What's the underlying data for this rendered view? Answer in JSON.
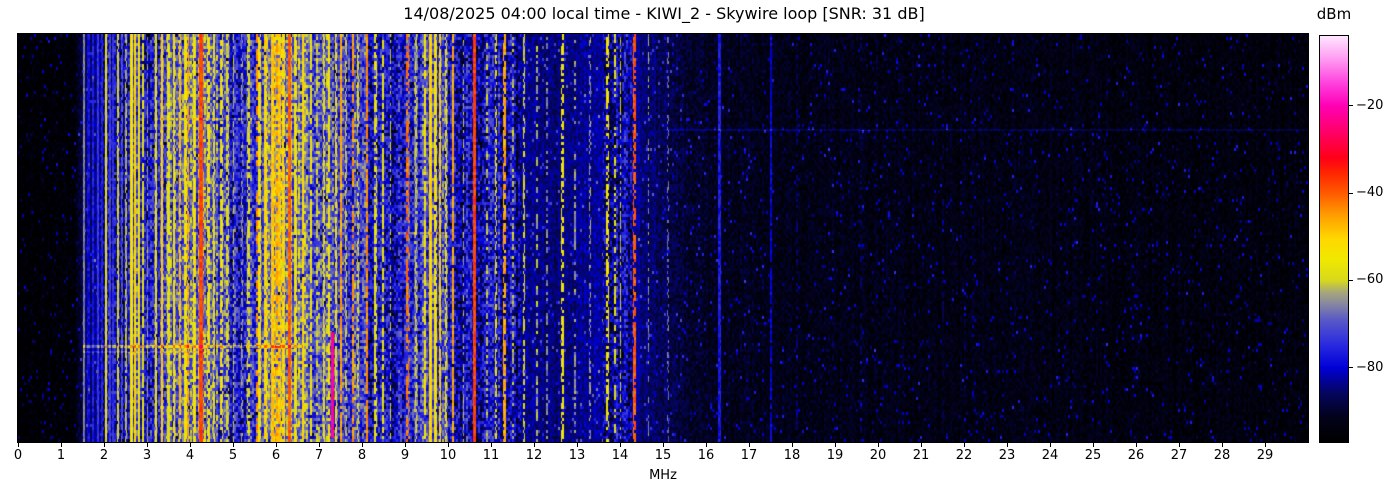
{
  "chart_data": {
    "type": "heatmap",
    "variant": "radio-spectrum-waterfall",
    "title": "14/08/2025 04:00 local time - KIWI_2 - Skywire loop [SNR: 31 dB]",
    "datetime_local": "14/08/2025 04:00",
    "station": "KIWI_2",
    "antenna": "Skywire loop",
    "snr_db": 31,
    "xlabel": "MHz",
    "x_range": [
      0,
      30
    ],
    "x_ticks": [
      0,
      1,
      2,
      3,
      4,
      5,
      6,
      7,
      8,
      9,
      10,
      11,
      12,
      13,
      14,
      15,
      16,
      17,
      18,
      19,
      20,
      21,
      22,
      23,
      24,
      25,
      26,
      27,
      28,
      29
    ],
    "value_label": "dBm",
    "value_range": [
      -97,
      -4
    ],
    "colorbar_ticks": [
      -20,
      -40,
      -60,
      -80
    ],
    "layout": {
      "grid": false,
      "colorbar_position": "right",
      "time_axis": "vertical-unlabeled"
    },
    "colormap": [
      [
        0.0,
        "#000000"
      ],
      [
        0.06,
        "#02021a"
      ],
      [
        0.12,
        "#05055e"
      ],
      [
        0.183,
        "#0000d6"
      ],
      [
        0.24,
        "#2a2ae0"
      ],
      [
        0.3,
        "#5858c8"
      ],
      [
        0.345,
        "#8c8c9c"
      ],
      [
        0.37,
        "#a8a878"
      ],
      [
        0.398,
        "#d8d81c"
      ],
      [
        0.45,
        "#f0e800"
      ],
      [
        0.5,
        "#ffd800"
      ],
      [
        0.56,
        "#ff9c00"
      ],
      [
        0.613,
        "#ff5a00"
      ],
      [
        0.66,
        "#ff2800"
      ],
      [
        0.7,
        "#ff0018"
      ],
      [
        0.76,
        "#ff0064"
      ],
      [
        0.828,
        "#ff00b4"
      ],
      [
        0.88,
        "#ff3cdc"
      ],
      [
        0.94,
        "#ff96f0"
      ],
      [
        1.0,
        "#ffe6ff"
      ]
    ],
    "noise_floor_profile": [
      [
        0.0,
        -96
      ],
      [
        1.3,
        -96
      ],
      [
        1.5,
        -88
      ],
      [
        1.7,
        -84
      ],
      [
        1.9,
        -82
      ],
      [
        2.1,
        -78
      ],
      [
        2.5,
        -80
      ],
      [
        2.7,
        -72
      ],
      [
        3.1,
        -76
      ],
      [
        3.4,
        -70
      ],
      [
        3.9,
        -68
      ],
      [
        4.3,
        -66
      ],
      [
        4.8,
        -72
      ],
      [
        5.1,
        -78
      ],
      [
        5.5,
        -72
      ],
      [
        5.8,
        -66
      ],
      [
        6.2,
        -64
      ],
      [
        6.6,
        -66
      ],
      [
        6.9,
        -72
      ],
      [
        7.2,
        -68
      ],
      [
        7.5,
        -74
      ],
      [
        7.9,
        -72
      ],
      [
        8.3,
        -78
      ],
      [
        8.7,
        -80
      ],
      [
        9.1,
        -74
      ],
      [
        9.5,
        -72
      ],
      [
        9.9,
        -74
      ],
      [
        10.3,
        -79
      ],
      [
        10.8,
        -80
      ],
      [
        11.3,
        -78
      ],
      [
        11.7,
        -82
      ],
      [
        12.3,
        -85
      ],
      [
        12.9,
        -84
      ],
      [
        13.6,
        -82
      ],
      [
        14.1,
        -80
      ],
      [
        14.6,
        -85
      ],
      [
        15.2,
        -88
      ],
      [
        16.0,
        -91
      ],
      [
        18.0,
        -92
      ],
      [
        21.0,
        -93
      ],
      [
        24.0,
        -93
      ],
      [
        27.0,
        -94
      ],
      [
        30.0,
        -94
      ]
    ],
    "carrier_format": "[freq_MHz, peak_dBm, width_MHz, duty_0to1, t_start_frac(optional), t_end_frac(optional)]",
    "carriers": [
      [
        1.52,
        -66,
        0.02,
        1
      ],
      [
        1.62,
        -78,
        0.04,
        1
      ],
      [
        1.74,
        -76,
        0.03,
        1
      ],
      [
        1.85,
        -73,
        0.02,
        1
      ],
      [
        1.95,
        -76,
        0.02,
        1
      ],
      [
        2.03,
        -56,
        0.03,
        1
      ],
      [
        2.12,
        -72,
        0.03,
        1
      ],
      [
        2.2,
        -74,
        0.03,
        1
      ],
      [
        2.32,
        -59,
        0.02,
        0.9
      ],
      [
        2.41,
        -70,
        0.02,
        0.8
      ],
      [
        2.49,
        -62,
        0.02,
        0.8
      ],
      [
        2.62,
        -54,
        0.04,
        1
      ],
      [
        2.71,
        -51,
        0.04,
        1
      ],
      [
        2.8,
        -54,
        0.04,
        1
      ],
      [
        2.89,
        -57,
        0.03,
        0.9
      ],
      [
        3.0,
        -64,
        0.02,
        0.7
      ],
      [
        3.2,
        -56,
        0.03,
        0.9
      ],
      [
        3.33,
        -50,
        0.03,
        1
      ],
      [
        3.48,
        -57,
        0.04,
        0.85
      ],
      [
        3.62,
        -54,
        0.03,
        0.9
      ],
      [
        3.75,
        -49,
        0.03,
        0.85
      ],
      [
        3.88,
        -55,
        0.04,
        0.9
      ],
      [
        3.95,
        -46,
        0.03,
        0.75
      ],
      [
        4.1,
        -54,
        0.05,
        0.9
      ],
      [
        4.25,
        -38,
        0.07,
        1
      ],
      [
        4.42,
        -54,
        0.03,
        0.8
      ],
      [
        4.55,
        -57,
        0.03,
        0.8
      ],
      [
        4.72,
        -55,
        0.03,
        0.75
      ],
      [
        4.86,
        -59,
        0.03,
        0.7
      ],
      [
        5.0,
        -61,
        0.02,
        0.6
      ],
      [
        5.2,
        -64,
        0.02,
        0.5
      ],
      [
        5.35,
        -59,
        0.03,
        0.7
      ],
      [
        5.55,
        -44,
        0.03,
        0.5
      ],
      [
        5.6,
        -54,
        0.04,
        0.9
      ],
      [
        5.75,
        -51,
        0.04,
        0.9
      ],
      [
        5.9,
        -49,
        0.04,
        1
      ],
      [
        6.0,
        -46,
        0.04,
        0.6
      ],
      [
        6.07,
        -49,
        0.04,
        0.9
      ],
      [
        6.17,
        -51,
        0.04,
        0.9
      ],
      [
        6.3,
        -40,
        0.04,
        1
      ],
      [
        6.45,
        -54,
        0.04,
        0.85
      ],
      [
        6.62,
        -51,
        0.03,
        0.9
      ],
      [
        6.8,
        -56,
        0.03,
        0.8
      ],
      [
        6.95,
        -60,
        0.02,
        0.6
      ],
      [
        7.1,
        -57,
        0.03,
        0.8
      ],
      [
        7.22,
        -54,
        0.03,
        0.8
      ],
      [
        7.3,
        -22,
        0.04,
        1,
        0.73,
        0.99
      ],
      [
        7.38,
        -55,
        0.03,
        0.8
      ],
      [
        7.5,
        -46,
        0.03,
        0.95
      ],
      [
        7.62,
        -60,
        0.02,
        0.6
      ],
      [
        7.78,
        -45,
        0.03,
        0.8
      ],
      [
        7.9,
        -58,
        0.02,
        0.6
      ],
      [
        8.1,
        -44,
        0.03,
        0.9
      ],
      [
        8.3,
        -57,
        0.03,
        0.7
      ],
      [
        8.47,
        -56,
        0.03,
        0.7
      ],
      [
        8.65,
        -60,
        0.02,
        0.5
      ],
      [
        9.05,
        -42,
        0.04,
        0.6
      ],
      [
        9.25,
        -60,
        0.02,
        0.6
      ],
      [
        9.45,
        -54,
        0.03,
        0.8
      ],
      [
        9.58,
        -51,
        0.03,
        1
      ],
      [
        9.7,
        -54,
        0.03,
        0.9
      ],
      [
        9.8,
        -51,
        0.03,
        0.9
      ],
      [
        9.95,
        -56,
        0.03,
        0.7
      ],
      [
        10.1,
        -46,
        0.03,
        0.9
      ],
      [
        10.35,
        -62,
        0.02,
        0.5
      ],
      [
        10.6,
        -38,
        0.05,
        1
      ],
      [
        10.9,
        -62,
        0.02,
        0.5
      ],
      [
        11.1,
        -57,
        0.02,
        0.6
      ],
      [
        11.3,
        -46,
        0.03,
        0.8
      ],
      [
        11.5,
        -62,
        0.02,
        0.5
      ],
      [
        11.75,
        -59,
        0.02,
        0.6
      ],
      [
        12.05,
        -62,
        0.02,
        0.5
      ],
      [
        12.3,
        -66,
        0.02,
        0.5
      ],
      [
        12.65,
        -55,
        0.03,
        0.6
      ],
      [
        12.95,
        -64,
        0.02,
        0.4
      ],
      [
        13.3,
        -64,
        0.02,
        0.4
      ],
      [
        13.7,
        -54,
        0.03,
        0.6
      ],
      [
        13.87,
        -58,
        0.02,
        0.5
      ],
      [
        14.0,
        -60,
        0.02,
        0.5
      ],
      [
        14.32,
        -40,
        0.04,
        0.8
      ],
      [
        14.65,
        -64,
        0.02,
        0.4
      ],
      [
        15.1,
        -68,
        0.02,
        0.4
      ],
      [
        16.3,
        -77,
        0.05,
        1
      ],
      [
        17.5,
        -80,
        0.03,
        0.95
      ],
      [
        18.1,
        -86,
        0.02,
        0.5
      ],
      [
        19.6,
        -87,
        0.02,
        0.4
      ],
      [
        21.5,
        -88,
        0.02,
        0.35
      ]
    ],
    "time_events_note": "horizontal noise streaks: t = fraction from top of plot",
    "time_events": [
      {
        "t": 0.206,
        "f0": 3.2,
        "f1": 5.6,
        "boost": 7,
        "rows": 2
      },
      {
        "t": 0.233,
        "f0": 15.0,
        "f1": 30.0,
        "boost": 6,
        "rows": 2
      },
      {
        "t": 0.485,
        "f0": 8.8,
        "f1": 11.6,
        "boost": 5,
        "rows": 2
      },
      {
        "t": 0.762,
        "f0": 1.5,
        "f1": 6.6,
        "boost": 12,
        "rows": 3
      },
      {
        "t": 0.778,
        "f0": 1.5,
        "f1": 4.5,
        "boost": 6,
        "rows": 2
      }
    ]
  }
}
